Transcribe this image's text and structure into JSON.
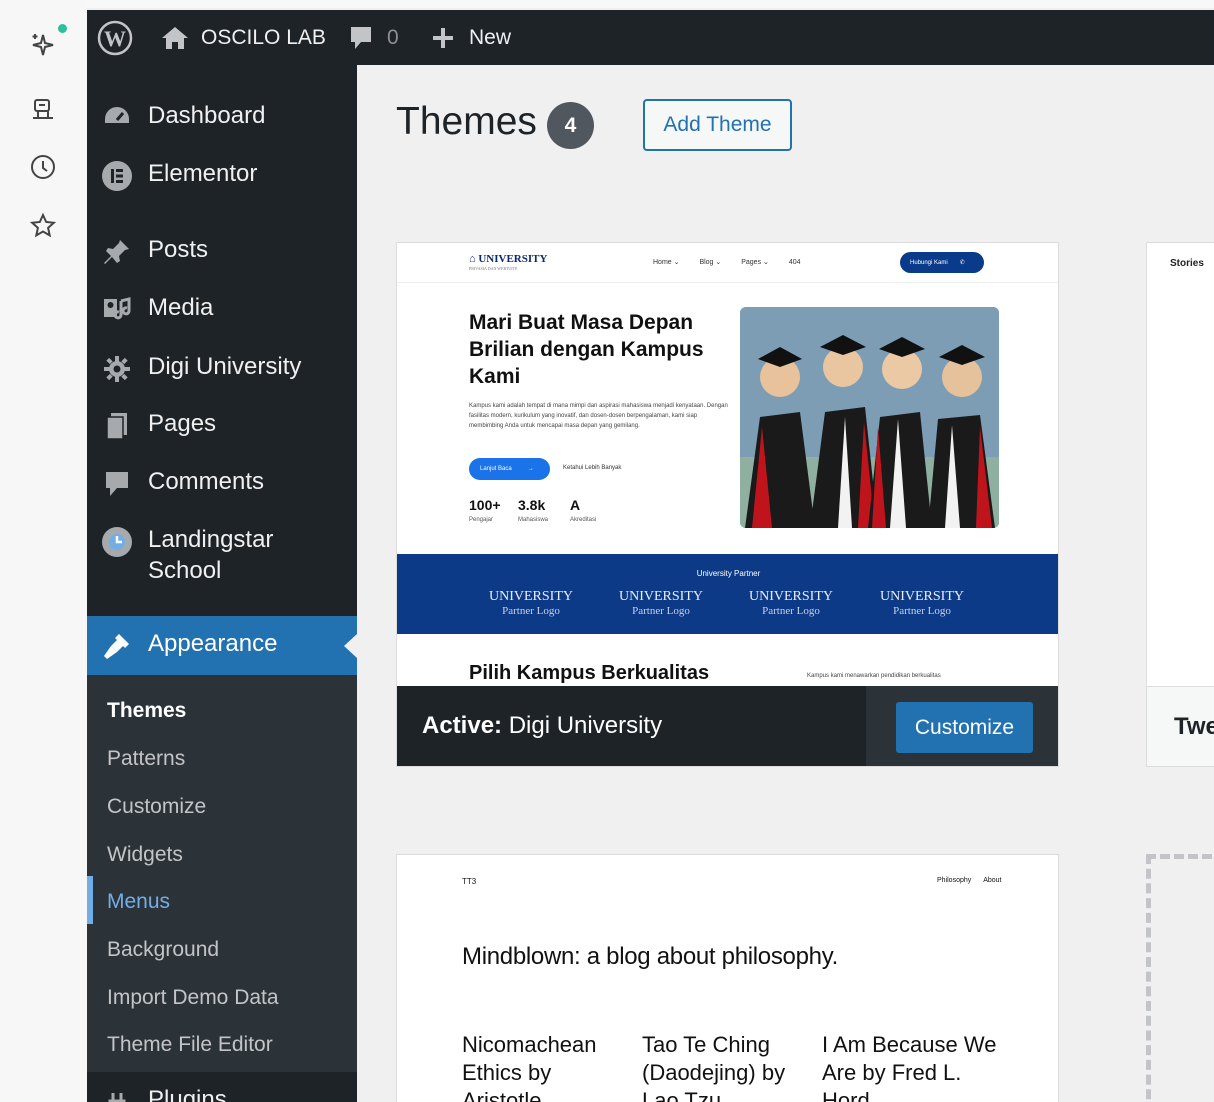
{
  "colors": {
    "adminbar": "#1d2327",
    "accent": "#2271b1",
    "submenu_hover": "#72aee6",
    "notification_dot": "#2bbf9a"
  },
  "side_rail": {
    "icons": [
      "sparkle-icon",
      "robot-icon",
      "clock-icon",
      "star-icon"
    ]
  },
  "adminbar": {
    "site_name": "OSCILO LAB",
    "comment_count": "0",
    "new_label": "New"
  },
  "menu": {
    "items": [
      {
        "label": "Dashboard",
        "icon": "dashboard-icon"
      },
      {
        "label": "Elementor",
        "icon": "elementor-icon"
      },
      {
        "label": "Posts",
        "icon": "pin-icon"
      },
      {
        "label": "Media",
        "icon": "media-icon"
      },
      {
        "label": "Digi University",
        "icon": "gear-icon"
      },
      {
        "label": "Pages",
        "icon": "pages-icon"
      },
      {
        "label": "Comments",
        "icon": "comment-icon"
      },
      {
        "label": "Landingstar",
        "label2": "School",
        "icon": "landingstar-icon"
      }
    ],
    "appearance": "Appearance",
    "submenu": [
      "Themes",
      "Patterns",
      "Customize",
      "Widgets",
      "Menus",
      "Background",
      "Import Demo Data",
      "Theme File Editor"
    ],
    "plugins_partial": "Plugins"
  },
  "page": {
    "title": "Themes",
    "count": "4",
    "add_button": "Add Theme"
  },
  "active_theme": {
    "active_prefix": "Active:",
    "name": "Digi University",
    "customize": "Customize",
    "screenshot": {
      "logo": "UNIVERSITY",
      "logo_sub": "PRIVASIA DAN WERTUITE",
      "nav": [
        "Home ⌄",
        "Blog ⌄",
        "Pages ⌄",
        "404"
      ],
      "cta": "Hubungi Kami",
      "hero_title": "Mari Buat Masa Depan Brilian dengan Kampus Kami",
      "hero_text": "Kampus kami adalah tempat di mana mimpi dan aspirasi mahasiswa menjadi kenyataan. Dengan fasilitas modern, kurikulum yang inovatif, dan dosen-dosen berpengalaman, kami siap membimbing Anda untuk mencapai masa depan yang gemilang.",
      "btn_primary": "Lanjut Baca",
      "btn_secondary": "Ketahui Lebih Banyak",
      "stats": [
        {
          "value": "100+",
          "label": "Pengajar"
        },
        {
          "value": "3.8k",
          "label": "Mahasiswa"
        },
        {
          "value": "A",
          "label": "Akreditasi"
        }
      ],
      "partner_title": "University Partner",
      "partner_logo": "UNIVERSITY",
      "partner_logo_sub": "Partner Logo",
      "section_title": "Pilih Kampus Berkualitas",
      "section_text": "Kampus kami menawarkan pendidikan berkualitas"
    }
  },
  "second_theme": {
    "top_label": "Stories",
    "name_partial": "Twe"
  },
  "third_theme": {
    "logo": "TT3",
    "nav": [
      "Philosophy",
      "About"
    ],
    "headline": "Mindblown: a blog about philosophy.",
    "posts": [
      "Nicomachean Ethics by Aristotle",
      "Tao Te Ching (Daodejing) by Lao Tzu",
      "I Am Because We Are by Fred L. Hord"
    ]
  }
}
